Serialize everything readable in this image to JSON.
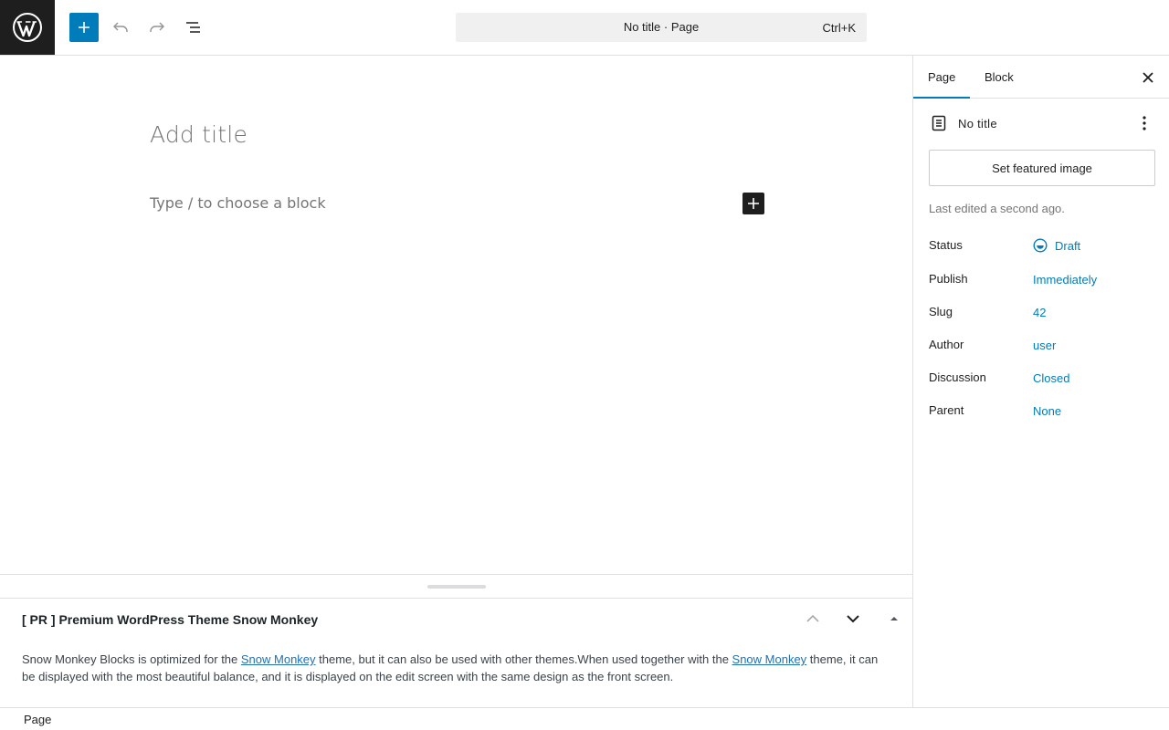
{
  "toolbar": {
    "inserter_label": "Toggle block inserter",
    "command": {
      "title": "No title · Page",
      "shortcut": "Ctrl+K"
    }
  },
  "canvas": {
    "title_placeholder": "Add title",
    "block_placeholder": "Type / to choose a block"
  },
  "metabox": {
    "title": "[ PR ] Premium WordPress Theme Snow Monkey",
    "body": {
      "part1": "Snow Monkey Blocks is optimized for the ",
      "link1": "Snow Monkey",
      "part2": " theme, but it can also be used with other themes.When used together with the ",
      "link2": "Snow Monkey",
      "part3": " theme, it can be displayed with the most beautiful balance, and it is displayed on the edit screen with the same design as the front screen."
    }
  },
  "footer": {
    "breadcrumb": "Page"
  },
  "sidebar": {
    "tabs": [
      {
        "label": "Page",
        "active": true
      },
      {
        "label": "Block",
        "active": false
      }
    ],
    "document_title": "No title",
    "featured_image_label": "Set featured image",
    "last_edited": "Last edited a second ago.",
    "meta": {
      "status": {
        "label": "Status",
        "value": "Draft"
      },
      "publish": {
        "label": "Publish",
        "value": "Immediately"
      },
      "slug": {
        "label": "Slug",
        "value": "42"
      },
      "author": {
        "label": "Author",
        "value": "user"
      },
      "discussion": {
        "label": "Discussion",
        "value": "Closed"
      },
      "parent": {
        "label": "Parent",
        "value": "None"
      }
    }
  },
  "colors": {
    "accent": "#007cba",
    "dark": "#1e1e1e",
    "muted": "#757575"
  }
}
